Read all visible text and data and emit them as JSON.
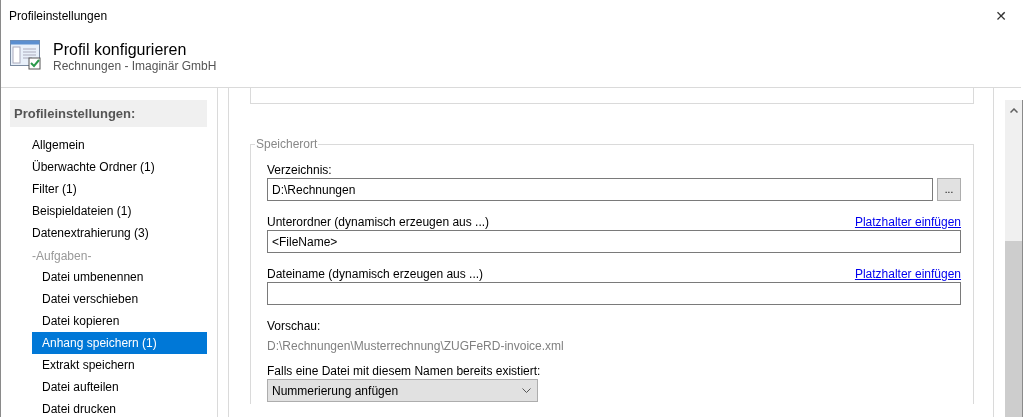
{
  "window": {
    "title": "Profileinstellungen",
    "close": "✕"
  },
  "header": {
    "title": "Profil konfigurieren",
    "subtitle": "Rechnungen - Imaginär GmbH"
  },
  "sidebar": {
    "heading": "Profileinstellungen:",
    "items": [
      {
        "label": "Allgemein",
        "selected": false
      },
      {
        "label": "Überwachte Ordner (1)",
        "selected": false
      },
      {
        "label": "Filter (1)",
        "selected": false
      },
      {
        "label": "Beispieldateien (1)",
        "selected": false
      },
      {
        "label": "Datenextrahierung (3)",
        "selected": false
      },
      {
        "label": "-Aufgaben-",
        "kind": "group",
        "children": [
          {
            "label": "Datei umbenennen",
            "selected": false
          },
          {
            "label": "Datei verschieben",
            "selected": false
          },
          {
            "label": "Datei kopieren",
            "selected": false
          },
          {
            "label": "Anhang speichern (1)",
            "selected": true
          },
          {
            "label": "Extrakt speichern",
            "selected": false
          },
          {
            "label": "Datei aufteilen",
            "selected": false
          },
          {
            "label": "Datei drucken",
            "selected": false
          }
        ]
      }
    ]
  },
  "group": {
    "title": "Speicherort",
    "fields": [
      {
        "kind": "path",
        "label": "Verzeichnis:",
        "value": "D:\\Rechnungen",
        "button": "..."
      },
      {
        "kind": "text",
        "label": "Unterordner (dynamisch erzeugen aus ...)",
        "link": "Platzhalter einfügen",
        "value": "<FileName>"
      },
      {
        "kind": "text",
        "label": "Dateiname (dynamisch erzeugen aus ...)",
        "link": "Platzhalter einfügen"
      },
      {
        "kind": "preview",
        "label": "Vorschau:",
        "value": "D:\\Rechnungen\\Musterrechnung\\ZUGFeRD-invoice.xml"
      },
      {
        "kind": "select",
        "label": "Falls eine Datei mit diesem Namen bereits existiert:",
        "value": "Nummerierung anfügen"
      }
    ]
  }
}
